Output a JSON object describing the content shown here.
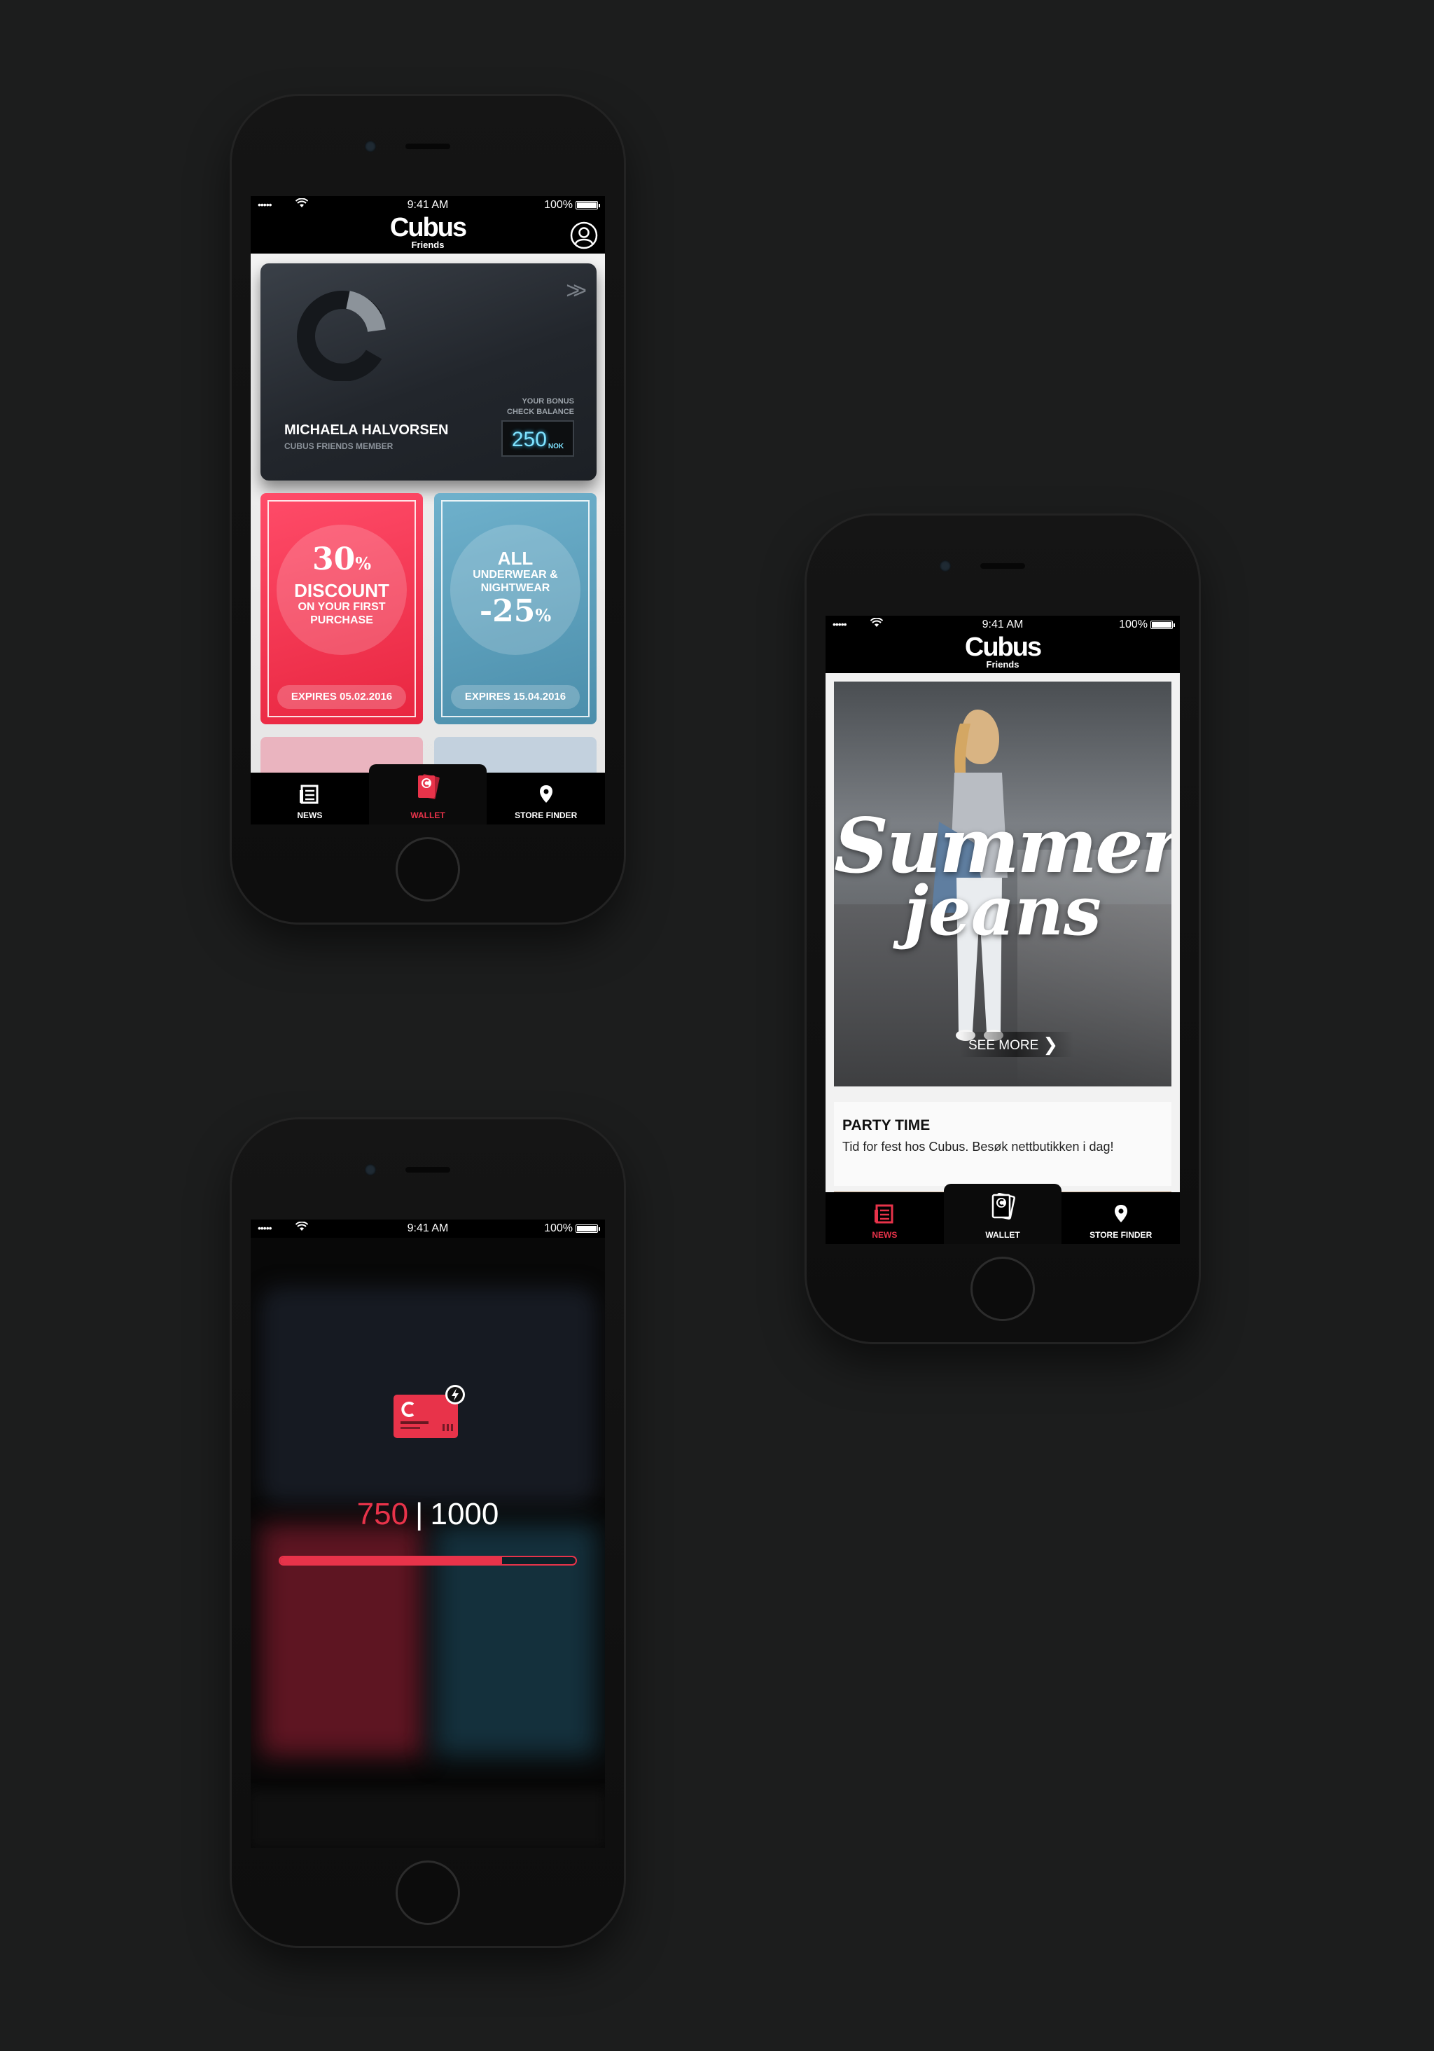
{
  "status": {
    "time": "9:41 AM",
    "battery": "100%",
    "signal": "•••••"
  },
  "brand": {
    "name": "Cubus",
    "sub": "Friends"
  },
  "tabs": {
    "news": "NEWS",
    "wallet": "WALLET",
    "store_finder": "STORE FINDER"
  },
  "wallet": {
    "card": {
      "arrow": ">>",
      "name": "MICHAELA HALVORSEN",
      "member_type": "CUBUS FRIENDS MEMBER",
      "bonus_label_1": "YOUR BONUS",
      "bonus_label_2": "CHECK BALANCE",
      "bonus_value": "250",
      "bonus_unit": "NOK"
    },
    "coupons": [
      {
        "line1": "30",
        "pct": "%",
        "line2": "DISCOUNT",
        "line3": "ON YOUR FIRST",
        "line4": "PURCHASE",
        "expires": "EXPIRES 05.02.2016"
      },
      {
        "line1": "ALL",
        "line2": "UNDERWEAR &",
        "line3": "NIGHTWEAR",
        "line4": "-25",
        "pct": "%",
        "expires": "EXPIRES 15.04.2016"
      }
    ]
  },
  "news": {
    "hero_title_1": "Summer",
    "hero_title_2": "jeans",
    "see_more": "SEE MORE",
    "see_more_arrow": "❯",
    "item_title": "PARTY TIME",
    "item_text": "Tid for fest hos Cubus. Besøk nettbutikken i dag!"
  },
  "loading": {
    "current": "750",
    "separator": "|",
    "total": "1000",
    "progress": 0.75
  },
  "colors": {
    "accent": "#e8334a",
    "coupon_red": "#f33555",
    "coupon_blue": "#5d9fbd",
    "bonus_glow": "#7fe3ff"
  },
  "icons": [
    "wifi-icon",
    "battery-icon",
    "profile-icon",
    "news-icon",
    "wallet-icon",
    "store-pin-icon",
    "card-flash-icon"
  ]
}
